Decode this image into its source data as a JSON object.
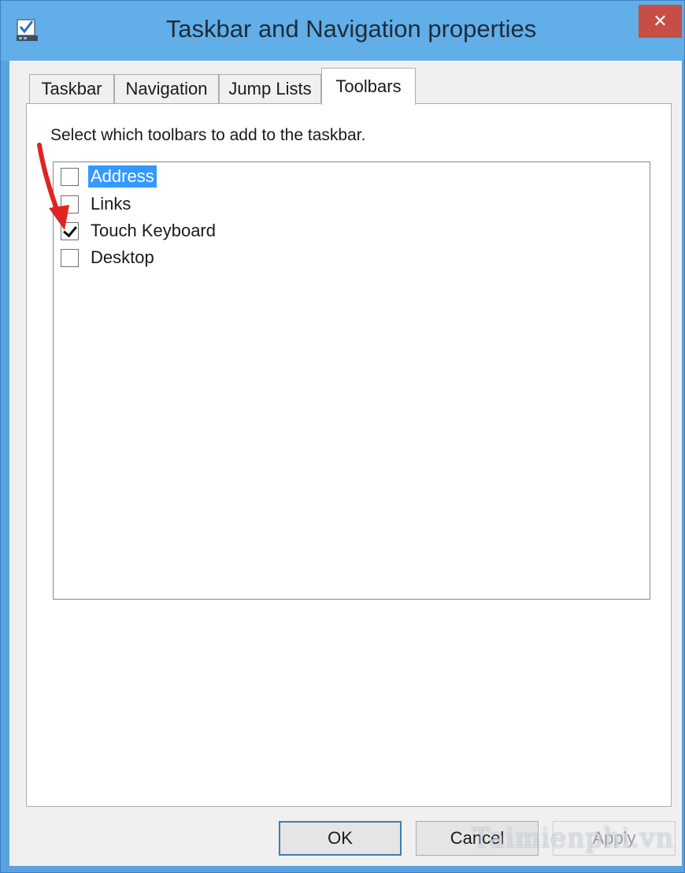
{
  "window": {
    "title": "Taskbar and Navigation properties",
    "close_glyph": "✕"
  },
  "tabs": [
    {
      "label": "Taskbar",
      "active": false
    },
    {
      "label": "Navigation",
      "active": false
    },
    {
      "label": "Jump Lists",
      "active": false
    },
    {
      "label": "Toolbars",
      "active": true
    }
  ],
  "toolbars_panel": {
    "instruction": "Select which toolbars to add to the taskbar.",
    "items": [
      {
        "label": "Address",
        "checked": false,
        "selected": true
      },
      {
        "label": "Links",
        "checked": false,
        "selected": false
      },
      {
        "label": "Touch Keyboard",
        "checked": true,
        "selected": false
      },
      {
        "label": "Desktop",
        "checked": false,
        "selected": false
      }
    ]
  },
  "buttons": {
    "ok": "OK",
    "cancel": "Cancel",
    "apply": "Apply"
  },
  "icons": {
    "app": "taskbar-properties-icon",
    "close": "close-icon",
    "annotation": "red-arrow-annotation"
  },
  "colors": {
    "titlebar": "#62aee8",
    "close_button": "#c74e45",
    "selection": "#3399ff",
    "annotation_arrow": "#e02424"
  },
  "watermark": "Taimienphi.vn"
}
